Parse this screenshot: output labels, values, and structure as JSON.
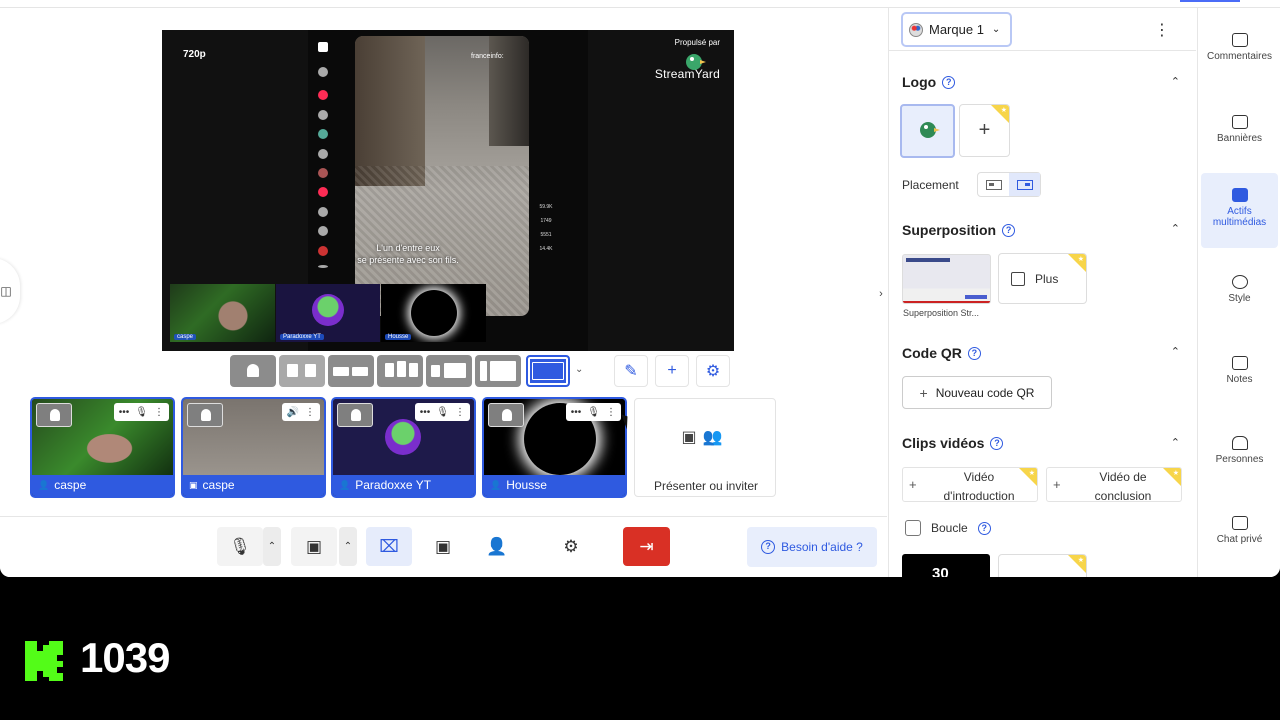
{
  "stage": {
    "resolution": "720p",
    "powered_by": "Propulsé par",
    "brand": "StreamYard",
    "tiktok_source": "franceinfo:",
    "subtitle_line1": "L'un d'entre eux",
    "subtitle_line2": "se présente avec son fils.",
    "tiktok_counts": [
      "59.9K",
      "1749",
      "5551",
      "14.4K"
    ],
    "in_stage_labels": [
      "caspe",
      "Paradoxxe YT",
      "Housse"
    ]
  },
  "participants": [
    {
      "name": "caspe",
      "type": "camera"
    },
    {
      "name": "caspe",
      "type": "screen"
    },
    {
      "name": "Paradoxxe YT",
      "type": "camera"
    },
    {
      "name": "Housse",
      "type": "camera"
    }
  ],
  "invite": {
    "label": "Présenter ou inviter"
  },
  "bottom_bar": {
    "help_label": "Besoin d'aide ?"
  },
  "panel": {
    "brand_selector": "Marque 1",
    "logo_title": "Logo",
    "placement_label": "Placement",
    "overlay_title": "Superposition",
    "overlay_more": "Plus",
    "overlay_caption": "Superposition Str...",
    "qr_title": "Code QR",
    "qr_button": "Nouveau code QR",
    "clips_title": "Clips vidéos",
    "clip_intro": "Vidéo d'introduction",
    "clip_outro": "Vidéo de conclusion",
    "loop_label": "Boucle",
    "timer_value": "30"
  },
  "right_nav": [
    {
      "label": "Commentaires",
      "icon": "comment-icon"
    },
    {
      "label": "Bannières",
      "icon": "banner-icon"
    },
    {
      "label": "Actifs multimédias",
      "icon": "media-icon",
      "active": true
    },
    {
      "label": "Style",
      "icon": "palette-icon"
    },
    {
      "label": "Notes",
      "icon": "notes-icon"
    },
    {
      "label": "Personnes",
      "icon": "people-icon"
    },
    {
      "label": "Chat privé",
      "icon": "chat-icon"
    }
  ],
  "overlay_counter": {
    "value": "1039",
    "logo": "kick-logo"
  },
  "colors": {
    "accent": "#2f5ae0",
    "leave": "#d93025",
    "premium": "#f7d54a"
  }
}
